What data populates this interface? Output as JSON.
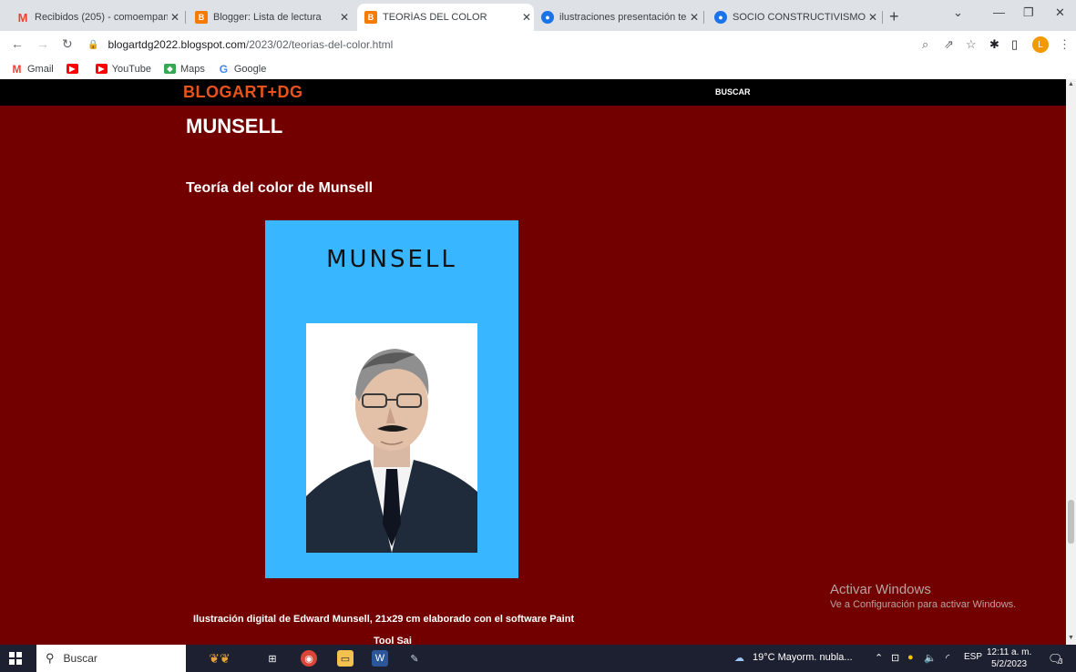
{
  "tabs": [
    {
      "title": "Recibidos (205) - comoempanar",
      "icon": "gmail-icon",
      "color": "#ea4335"
    },
    {
      "title": "Blogger: Lista de lectura",
      "icon": "blogger-icon",
      "color": "#f57c00"
    },
    {
      "title": "TEORÍAS DEL COLOR",
      "icon": "blogger-icon",
      "color": "#f57c00",
      "active": true
    },
    {
      "title": "ilustraciones presentación tesis",
      "icon": "site-icon",
      "color": "#1a73e8"
    },
    {
      "title": "SOCIO CONSTRUCTIVISMO - D",
      "icon": "site-icon",
      "color": "#1a73e8"
    }
  ],
  "address": {
    "host": "blogartdg2022.blogspot.com",
    "path": "/2023/02/teorias-del-color.html"
  },
  "profile_initial": "L",
  "bookmarks": [
    {
      "label": "Gmail",
      "icon": "gmail-icon",
      "color": "#ea4335"
    },
    {
      "label": "",
      "icon": "youtube-icon",
      "color": "#ff0000"
    },
    {
      "label": "YouTube",
      "icon": "youtube-icon",
      "color": "#ff0000"
    },
    {
      "label": "Maps",
      "icon": "maps-icon",
      "color": "#34a853"
    },
    {
      "label": "Google",
      "icon": "google-icon",
      "color": "#4285f4"
    }
  ],
  "site": {
    "brand": "BLOGART+DG",
    "search_link": "BUSCAR",
    "brand_color": "#e8531c",
    "background": "#730000"
  },
  "post": {
    "title": "MUNSELL",
    "subtitle": "Teoría del color de Munsell",
    "figure_text": "MUNSELL",
    "caption": "Ilustración digital de Edward Munsell, 21x29 cm elaborado con el software Paint",
    "caption2": "Tool Sai"
  },
  "watermark": {
    "line1": "Activar Windows",
    "line2": "Ve a Configuración para activar Windows."
  },
  "taskbar": {
    "search": "Buscar",
    "weather": "19°C  Mayorm. nubla...",
    "lang": "ESP",
    "time": "12:11 a. m.",
    "date": "5/2/2023",
    "notifications": "3"
  }
}
